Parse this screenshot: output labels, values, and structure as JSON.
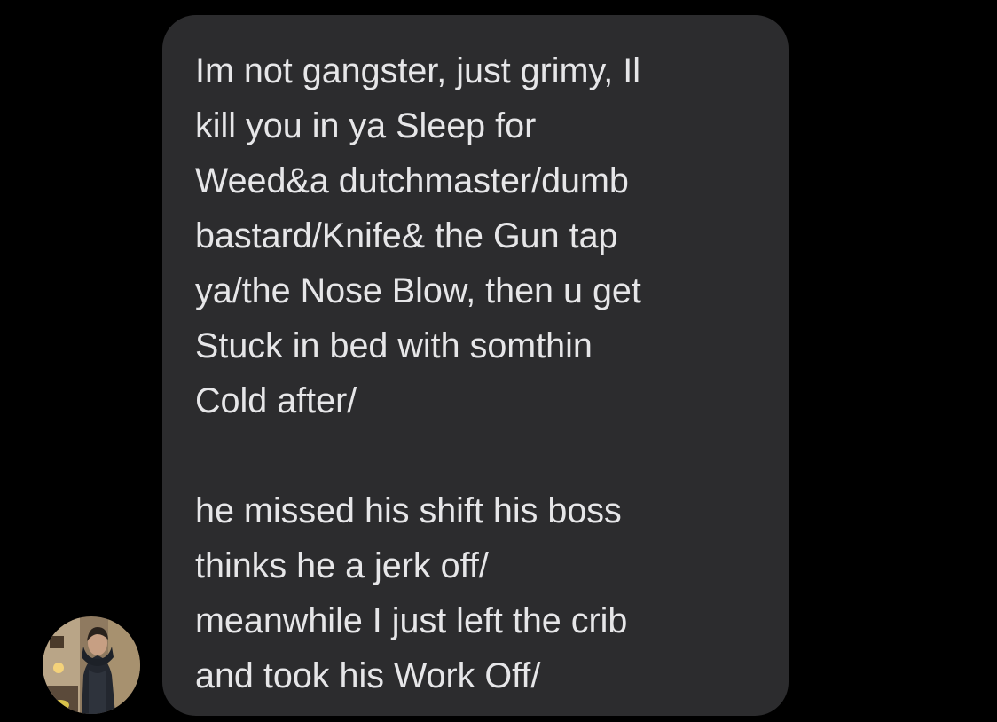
{
  "message": {
    "paragraphs": [
      {
        "lines": [
          "Im not gangster, just grimy, Il",
          "kill you in ya Sleep for",
          "Weed&a dutchmaster/dumb",
          "bastard/Knife& the Gun tap",
          "ya/the Nose Blow, then u get",
          "Stuck in bed with somthin",
          "Cold after/"
        ]
      },
      {
        "lines": [
          "he missed his shift his boss",
          "thinks he a jerk off/",
          "meanwhile I just left the crib",
          "and took his Work Off/"
        ]
      }
    ]
  },
  "avatar": {
    "icon": "contact-avatar-photo"
  },
  "colors": {
    "background": "#000000",
    "bubble": "#2c2c2e",
    "text": "#e6e6e8"
  }
}
